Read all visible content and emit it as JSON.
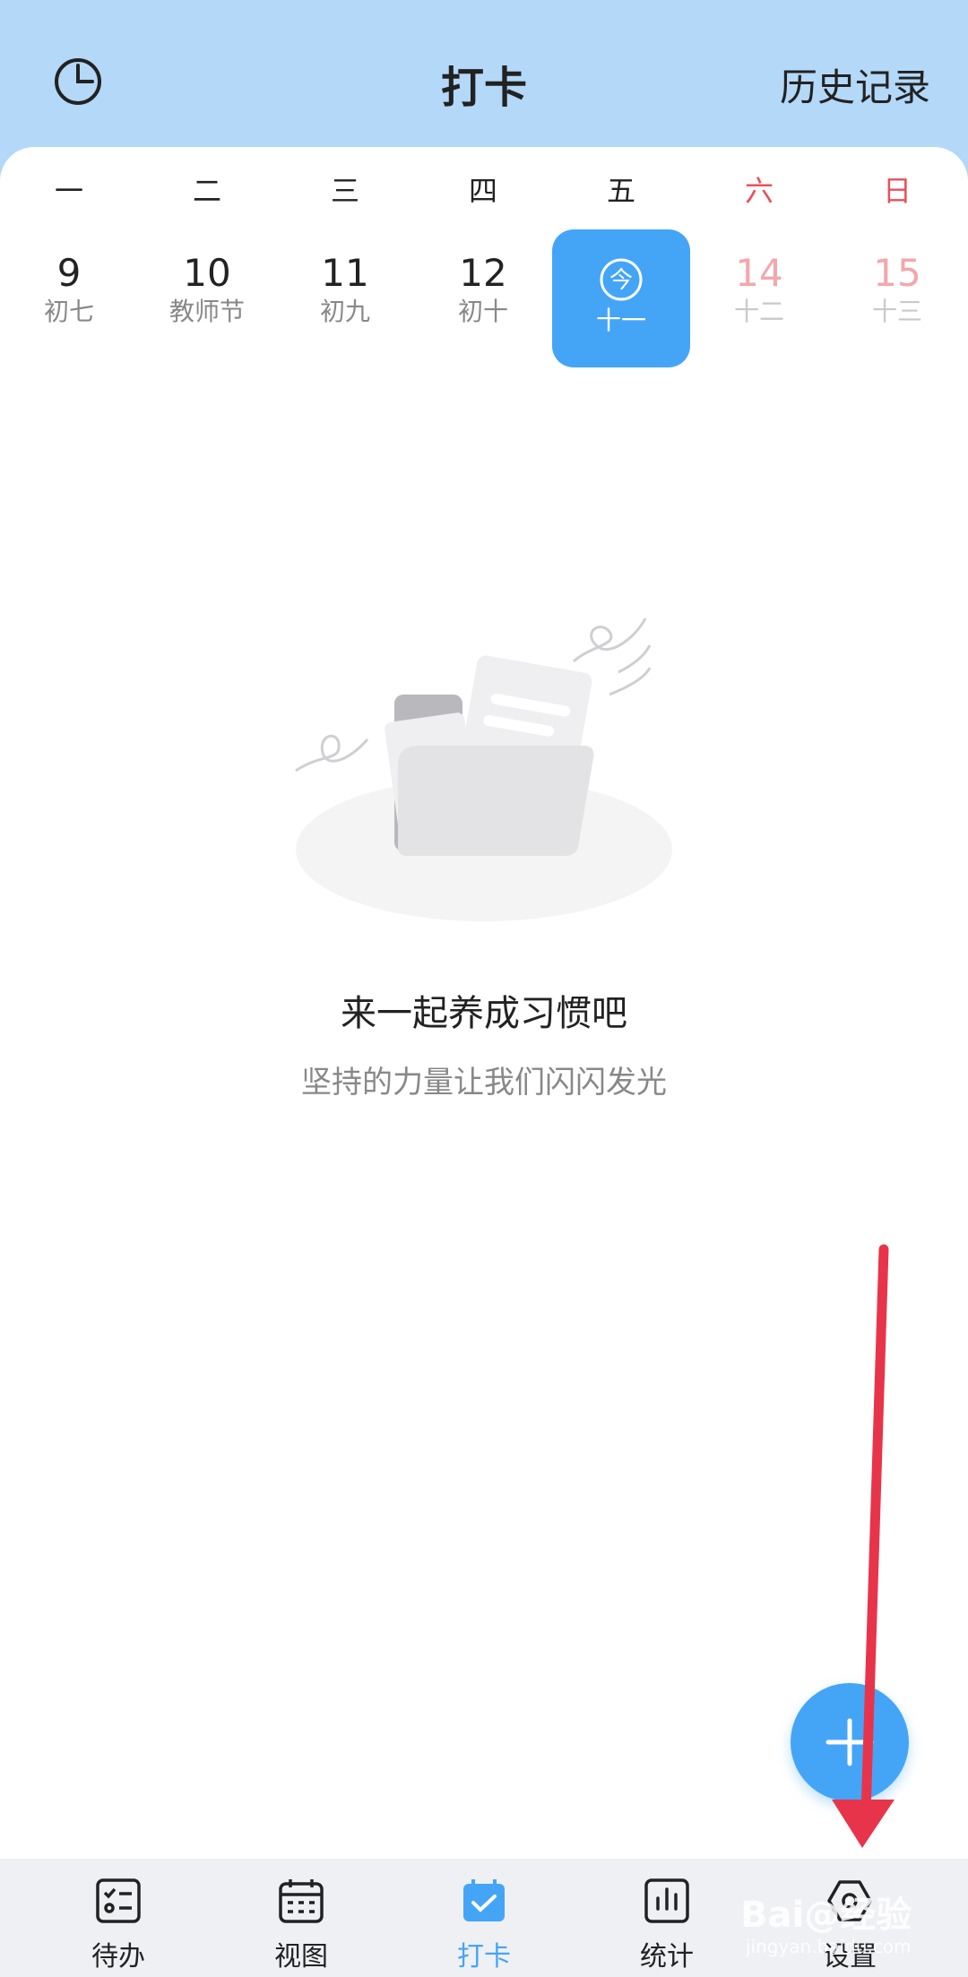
{
  "header": {
    "title": "打卡",
    "history_label": "历史记录"
  },
  "calendar": {
    "weekdays": [
      "一",
      "二",
      "三",
      "四",
      "五",
      "六",
      "日"
    ],
    "days": [
      {
        "num": "9",
        "lunar": "初七"
      },
      {
        "num": "10",
        "lunar": "教师节"
      },
      {
        "num": "11",
        "lunar": "初九"
      },
      {
        "num": "12",
        "lunar": "初十"
      },
      {
        "num": "",
        "lunar": "十一",
        "today_glyph": "今"
      },
      {
        "num": "14",
        "lunar": "十二"
      },
      {
        "num": "15",
        "lunar": "十三"
      }
    ]
  },
  "empty_state": {
    "title": "来一起养成习惯吧",
    "subtitle": "坚持的力量让我们闪闪发光"
  },
  "tabs": [
    {
      "label": "待办",
      "icon": "todo-list-icon"
    },
    {
      "label": "视图",
      "icon": "calendar-view-icon"
    },
    {
      "label": "打卡",
      "icon": "checkin-icon",
      "active": true
    },
    {
      "label": "统计",
      "icon": "stats-icon"
    },
    {
      "label": "设置",
      "icon": "settings-icon"
    }
  ],
  "watermark": {
    "text": "Bai@经验",
    "sub": "jingyan.baidu.com"
  },
  "colors": {
    "header_bg": "#b3d8f8",
    "accent": "#44a5f7",
    "weekend": "#e8505b",
    "annotation_arrow": "#e8344a"
  }
}
